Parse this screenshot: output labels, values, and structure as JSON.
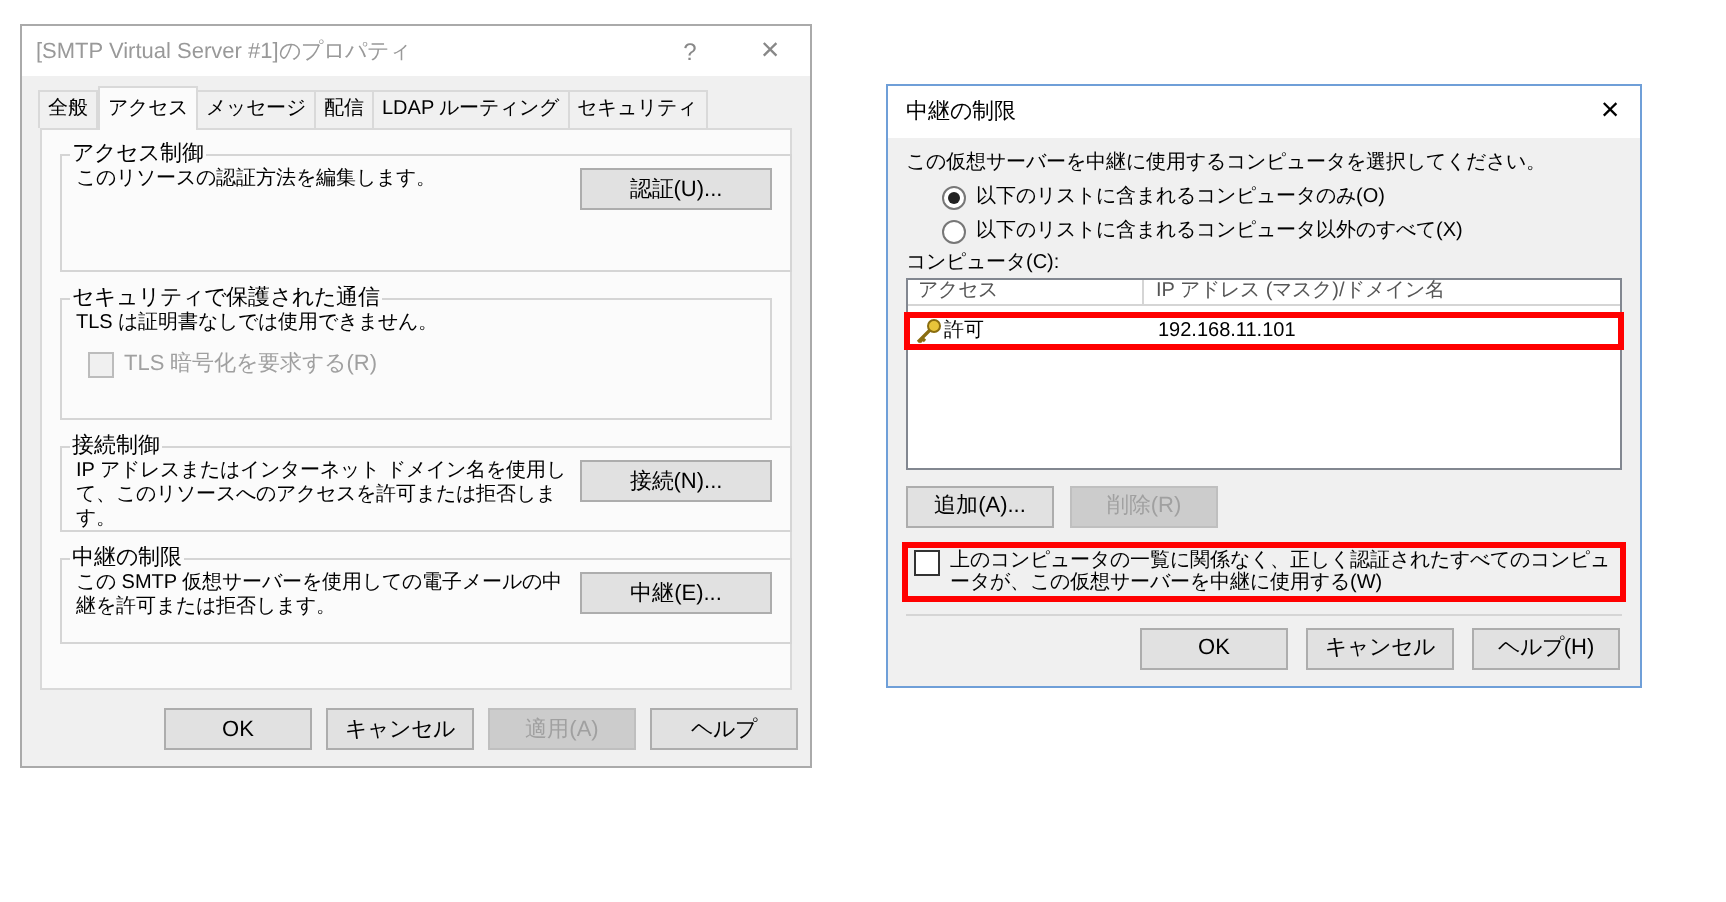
{
  "properties_dialog": {
    "title": "[SMTP Virtual Server #1]のプロパティ",
    "title_buttons": [
      "?",
      "×"
    ],
    "tabs": [
      {
        "label": "全般",
        "selected": false
      },
      {
        "label": "アクセス",
        "selected": true
      },
      {
        "label": "メッセージ",
        "selected": false
      },
      {
        "label": "配信",
        "selected": false
      },
      {
        "label": "LDAP ルーティング",
        "selected": false
      },
      {
        "label": "セキュリティ",
        "selected": false
      }
    ],
    "groups": [
      {
        "title": "アクセス制御",
        "description": "このリソースの認証方法を編集します。",
        "button": "認証(U)..."
      },
      {
        "title": "セキュリティで保護された通信",
        "description": "TLS は証明書なしでは使用できません。",
        "checkbox": {
          "label": "TLS 暗号化を要求する(R)",
          "checked": false,
          "disabled": true
        }
      },
      {
        "title": "接続制御",
        "description": "IP アドレスまたはインターネット ドメイン名を使用して、このリソースへのアクセスを許可または拒否します。",
        "button": "接続(N)..."
      },
      {
        "title": "中継の制限",
        "description": "この SMTP 仮想サーバーを使用しての電子メールの中継を許可または拒否します。",
        "button": "中継(E)..."
      }
    ],
    "buttons": [
      {
        "label": "OK",
        "disabled": false
      },
      {
        "label": "キャンセル",
        "disabled": false
      },
      {
        "label": "適用(A)",
        "disabled": true
      },
      {
        "label": "ヘルプ",
        "disabled": false
      }
    ]
  },
  "relay_dialog": {
    "title": "中継の制限",
    "close": "×",
    "instruction": "この仮想サーバーを中継に使用するコンピュータを選択してください。",
    "radios": [
      {
        "label": "以下のリストに含まれるコンピュータのみ(O)",
        "selected": true
      },
      {
        "label": "以下のリストに含まれるコンピュータ以外のすべて(X)",
        "selected": false
      }
    ],
    "list_label": "コンピュータ(C):",
    "columns": [
      "アクセス",
      "IP アドレス (マスク)/ドメイン名"
    ],
    "rows": [
      {
        "access": "許可",
        "address": "192.168.11.101",
        "highlighted": true
      }
    ],
    "list_buttons": [
      {
        "label": "追加(A)...",
        "disabled": false
      },
      {
        "label": "削除(R)",
        "disabled": true
      }
    ],
    "checkbox": {
      "label": "上のコンピュータの一覧に関係なく、正しく認証されたすべてのコンピュータが、この仮想サーバーを中継に使用する(W)",
      "checked": false,
      "highlighted": true
    },
    "buttons": [
      {
        "label": "OK",
        "disabled": false
      },
      {
        "label": "キャンセル",
        "disabled": false
      },
      {
        "label": "ヘルプ(H)",
        "disabled": false
      }
    ]
  }
}
